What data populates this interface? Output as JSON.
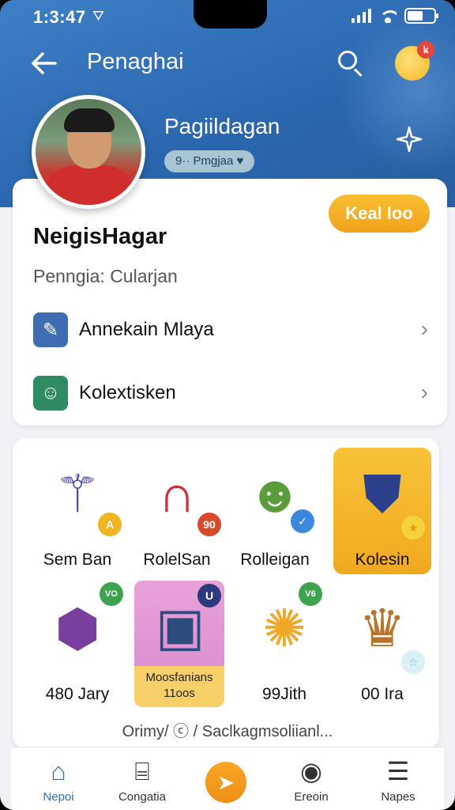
{
  "status": {
    "time": "1:3:47",
    "location_glyph": "⛛"
  },
  "header": {
    "title": "Penaghai",
    "notification_badge": "ꝃ",
    "display_name": "Pagiildagan",
    "rank_pill": "9·· Pmgjaa ♥"
  },
  "profile": {
    "follow_label": "Keal loo",
    "username": "NeigisHagar",
    "subtitle": "Penngia: Cularjan",
    "rows": [
      {
        "label": "Annekain Mlaya",
        "icon": "brush-shield-icon"
      },
      {
        "label": "Kolextisken",
        "icon": "character-portrait-icon"
      }
    ]
  },
  "collection": {
    "items": [
      {
        "label": "Sem Ban",
        "icon": "wand-icon",
        "badge": "A"
      },
      {
        "label": "RolelSan",
        "icon": "horseshoe-magnet-icon",
        "badge": "90"
      },
      {
        "label": "Rolleigan",
        "icon": "frog-creature-icon",
        "badge": "✓"
      },
      {
        "label": "Kolesin",
        "icon": "shield-crest-icon",
        "badge": "★"
      },
      {
        "label": "480 Jary",
        "icon": "gem-frame-icon",
        "badge": "VO"
      },
      {
        "label": "Moosfanians",
        "sublabel": "11oos",
        "icon": "spell-book-icon",
        "badge": "U"
      },
      {
        "label": "99Jith",
        "icon": "sun-monster-icon",
        "badge": "V6"
      },
      {
        "label": "00 Ira",
        "icon": "tribal-mask-icon",
        "badge": "☆"
      }
    ],
    "footer": "Orimy/ ⓒ / Saclkagmsoliianl..."
  },
  "nav": {
    "items": [
      {
        "label": "Nepoi",
        "icon": "home-icon"
      },
      {
        "label": "Congatia",
        "icon": "bag-icon"
      },
      {
        "label": "",
        "icon": "paper-plane-icon"
      },
      {
        "label": "Ereoin",
        "icon": "compass-icon"
      },
      {
        "label": "Napes",
        "icon": "menu-icon"
      }
    ]
  }
}
